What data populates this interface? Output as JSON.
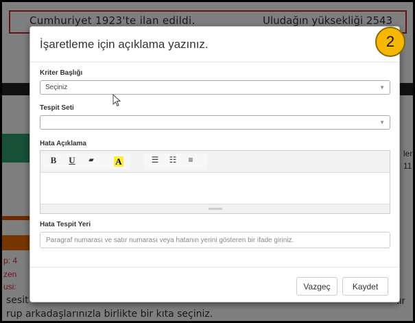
{
  "background": {
    "header_left": "Cumhuriyet 1923'te ilan edildi.",
    "header_right": "Uludağın yüksekliği 2543",
    "side_left_1": "p: 4",
    "side_left_2": "zen",
    "side_left_3": "usi:",
    "side_right": [
      "ler",
      "11"
    ],
    "bottom_line_1": "sesit",
    "bottom_line_2": "rup arkadaşlarınızla birlikte bir kıta seçiniz.",
    "bottom_right": "tır"
  },
  "modal": {
    "title": "İşaretleme için açıklama yazınız.",
    "step_number": "2",
    "criterion": {
      "label": "Kriter Başlığı",
      "selected": "Seçiniz"
    },
    "detection_set": {
      "label": "Tespit Seti",
      "selected": ""
    },
    "error_description": {
      "label": "Hata Açıklama",
      "toolbar": {
        "bold": "B",
        "underline": "U",
        "eraser": "▰",
        "highlight": "A",
        "bullet_list": "☰",
        "numbered_list": "☷",
        "align": "≡"
      }
    },
    "error_location": {
      "label": "Hata Tespit Yeri",
      "placeholder": "Paragraf numarası ve satır numarası veya hatanın yerini gösteren bir ifade giriniz."
    },
    "buttons": {
      "cancel": "Vazgeç",
      "save": "Kaydet"
    }
  },
  "colors": {
    "badge": "#f5b700",
    "highlight": "#ffeb3b",
    "background_accent_red": "#c62828"
  }
}
